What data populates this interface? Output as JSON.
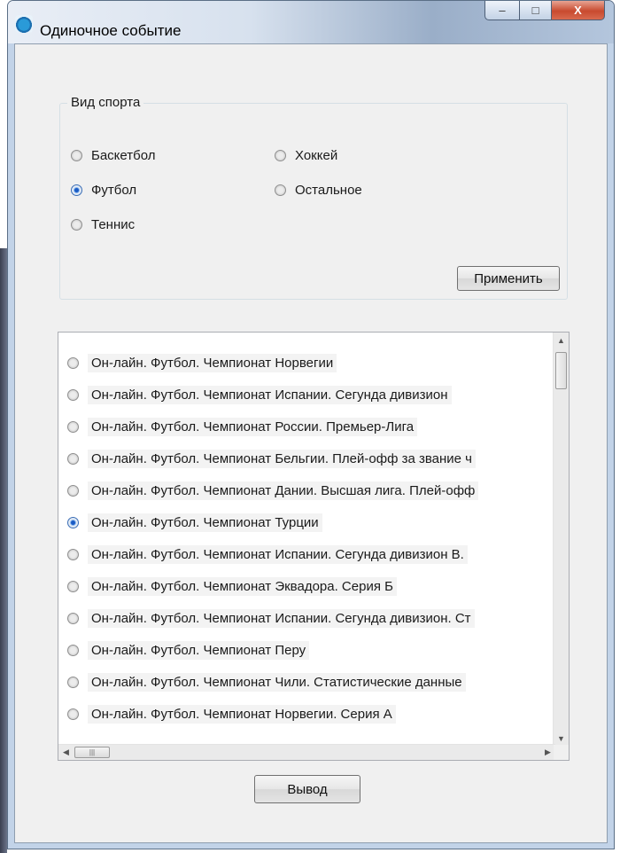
{
  "window": {
    "title": "Одиночное событие",
    "minimize_glyph": "–",
    "maximize_glyph": "□",
    "close_glyph": "X"
  },
  "sport_group": {
    "legend": "Вид спорта",
    "options": [
      {
        "label": "Баскетбол",
        "checked": false
      },
      {
        "label": "Хоккей",
        "checked": false
      },
      {
        "label": "Футбол",
        "checked": true
      },
      {
        "label": "Остальное",
        "checked": false
      },
      {
        "label": "Теннис",
        "checked": false
      }
    ],
    "apply_label": "Применить"
  },
  "events_list": {
    "items": [
      {
        "label": "Он-лайн. Футбол. Чемпионат Норвегии",
        "checked": false
      },
      {
        "label": "Он-лайн. Футбол. Чемпионат Испании. Сегунда дивизион",
        "checked": false
      },
      {
        "label": "Он-лайн. Футбол. Чемпионат России. Премьер-Лига",
        "checked": false
      },
      {
        "label": "Он-лайн. Футбол. Чемпионат Бельгии. Плей-офф за звание ч",
        "checked": false
      },
      {
        "label": "Он-лайн. Футбол. Чемпионат Дании. Высшая лига. Плей-офф",
        "checked": false
      },
      {
        "label": "Он-лайн. Футбол. Чемпионат Турции",
        "checked": true
      },
      {
        "label": "Он-лайн. Футбол. Чемпионат Испании. Сегунда дивизион В.",
        "checked": false
      },
      {
        "label": "Он-лайн. Футбол. Чемпионат Эквадора. Серия Б",
        "checked": false
      },
      {
        "label": "Он-лайн. Футбол. Чемпионат Испании. Сегунда дивизион. Ст",
        "checked": false
      },
      {
        "label": "Он-лайн. Футбол. Чемпионат Перу",
        "checked": false
      },
      {
        "label": "Он-лайн. Футбол. Чемпионат Чили. Статистические данные",
        "checked": false
      },
      {
        "label": "Он-лайн. Футбол. Чемпионат Норвегии. Серия А",
        "checked": false
      }
    ]
  },
  "output_label": "Вывод"
}
